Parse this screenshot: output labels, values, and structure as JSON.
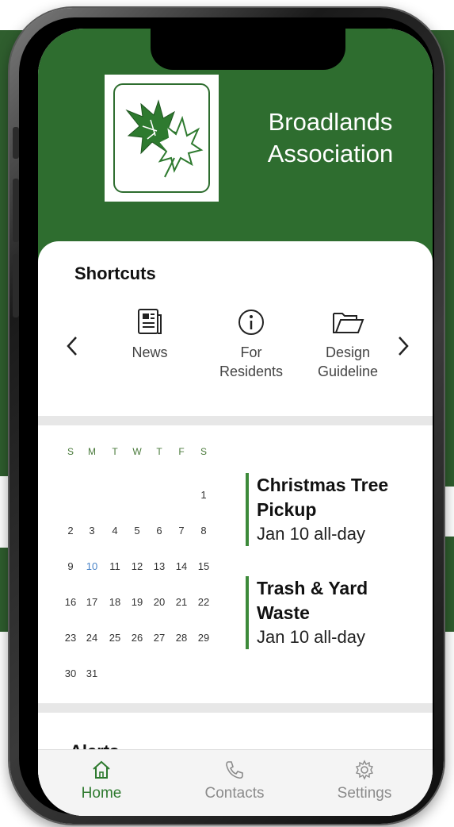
{
  "header": {
    "title_line1": "Broadlands",
    "title_line2": "Association",
    "logo_icon": "maple-leaf-logo"
  },
  "shortcuts": {
    "title": "Shortcuts",
    "prev_icon": "chevron-left-icon",
    "next_icon": "chevron-right-icon",
    "items": [
      {
        "label": "News",
        "icon": "newspaper-icon"
      },
      {
        "label_line1": "For",
        "label_line2": "Residents",
        "icon": "info-icon"
      },
      {
        "label_line1": "Design",
        "label_line2": "Guideline",
        "icon": "folder-icon"
      }
    ]
  },
  "calendar": {
    "weekdays": [
      "S",
      "M",
      "T",
      "W",
      "T",
      "F",
      "S"
    ],
    "weeks": [
      [
        "",
        "",
        "",
        "",
        "",
        "",
        "1"
      ],
      [
        "2",
        "3",
        "4",
        "5",
        "6",
        "7",
        "8"
      ],
      [
        "9",
        "10",
        "11",
        "12",
        "13",
        "14",
        "15"
      ],
      [
        "16",
        "17",
        "18",
        "19",
        "20",
        "21",
        "22"
      ],
      [
        "23",
        "24",
        "25",
        "26",
        "27",
        "28",
        "29"
      ],
      [
        "30",
        "31",
        "",
        "",
        "",
        "",
        ""
      ]
    ],
    "today": "10",
    "accent_color": "#4a84c8"
  },
  "events": [
    {
      "title_line1": "Christmas Tree",
      "title_line2": "Pickup",
      "time": "Jan 10 all-day"
    },
    {
      "title_line1": "Trash & Yard",
      "title_line2": "Waste",
      "time": "Jan 10 all-day"
    }
  ],
  "alerts": {
    "title": "Alerts"
  },
  "tabbar": {
    "tabs": [
      {
        "label": "Home",
        "icon": "home-icon",
        "active": true
      },
      {
        "label": "Contacts",
        "icon": "phone-icon",
        "active": false
      },
      {
        "label": "Settings",
        "icon": "gear-icon",
        "active": false
      }
    ]
  },
  "colors": {
    "brand_green": "#2e6d2f",
    "active_tab": "#2e7a2f",
    "event_bar": "#3d8a3a"
  }
}
